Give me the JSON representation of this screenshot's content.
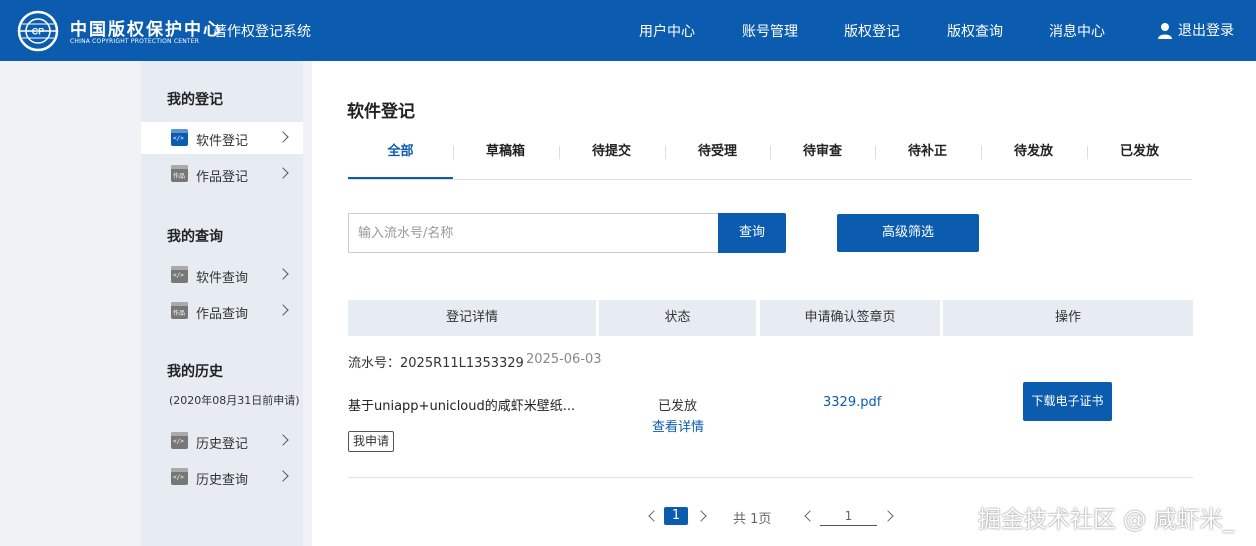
{
  "header": {
    "logo_cn": "中国版权保护中心",
    "logo_en": "CHINA COPYRIGHT PROTECTION CENTER",
    "system_name": "著作权登记系统",
    "nav": [
      "用户中心",
      "账号管理",
      "版权登记",
      "版权查询",
      "消息中心"
    ],
    "logout": "退出登录"
  },
  "sidebar": {
    "sections": [
      {
        "title": "我的登记",
        "items": [
          {
            "label": "软件登记",
            "active": true,
            "icon": "</>"
          },
          {
            "label": "作品登记",
            "active": false,
            "icon": "作品"
          }
        ]
      },
      {
        "title": "我的查询",
        "items": [
          {
            "label": "软件查询",
            "active": false,
            "icon": "</>"
          },
          {
            "label": "作品查询",
            "active": false,
            "icon": "作品"
          }
        ]
      },
      {
        "title": "我的历史",
        "note": "(2020年08月31日前申请)",
        "items": [
          {
            "label": "历史登记",
            "active": false,
            "icon": "</>"
          },
          {
            "label": "历史查询",
            "active": false,
            "icon": "</>"
          }
        ]
      }
    ]
  },
  "main": {
    "title": "软件登记",
    "tabs": [
      "全部",
      "草稿箱",
      "待提交",
      "待受理",
      "待审查",
      "待补正",
      "待发放",
      "已发放"
    ],
    "active_tab": 0,
    "search": {
      "placeholder": "输入流水号/名称",
      "value": "",
      "button": "查询"
    },
    "filter_button": "高级筛选",
    "table_headers": [
      "登记详情",
      "状态",
      "申请确认签章页",
      "操作"
    ],
    "rows": [
      {
        "serial": "流水号：2025R11L1353329",
        "date": "2025-06-03",
        "name": "基于uniapp+unicloud的咸虾米壁纸...",
        "tag": "我申请",
        "status": "已发放",
        "detail_link": "查看详情",
        "pdf": "3329.pdf",
        "action": "下载电子证书"
      }
    ]
  },
  "pagination": {
    "current": "1",
    "total": "共 1页",
    "jump_value": "1"
  },
  "watermark": "掘金技术社区 @ 咸虾米_",
  "colors": {
    "primary": "#0b5cae",
    "sidebar_bg": "#e7ecf3",
    "page_bg": "#f0f2f5"
  }
}
